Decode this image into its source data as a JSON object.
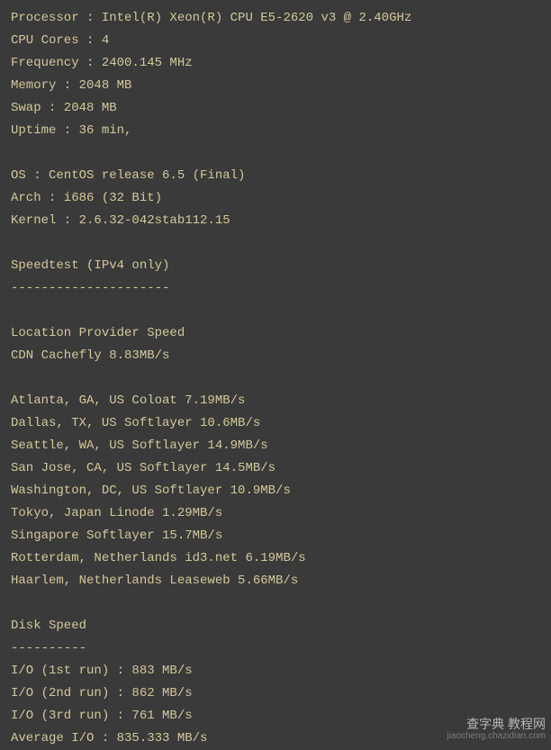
{
  "system": {
    "processor": "Processor : Intel(R) Xeon(R) CPU E5-2620 v3 @ 2.40GHz",
    "cores": "CPU Cores : 4",
    "frequency": "Frequency : 2400.145 MHz",
    "memory": "Memory : 2048 MB",
    "swap": "Swap : 2048 MB",
    "uptime": "Uptime : 36 min,"
  },
  "os_info": {
    "os": "OS : CentOS release 6.5 (Final)",
    "arch": "Arch : i686 (32 Bit)",
    "kernel": "Kernel : 2.6.32-042stab112.15"
  },
  "speedtest": {
    "header": "Speedtest (IPv4 only)",
    "divider": "---------------------",
    "section_header": "Location Provider Speed",
    "cdn": "CDN Cachefly 8.83MB/s",
    "locations": {
      "atlanta": "Atlanta, GA, US Coloat 7.19MB/s",
      "dallas": "Dallas, TX, US Softlayer 10.6MB/s",
      "seattle": "Seattle, WA, US Softlayer 14.9MB/s",
      "sanjose": "San Jose, CA, US Softlayer 14.5MB/s",
      "washington": "Washington, DC, US Softlayer 10.9MB/s",
      "tokyo": "Tokyo, Japan Linode 1.29MB/s",
      "singapore": "Singapore Softlayer 15.7MB/s",
      "rotterdam": "Rotterdam, Netherlands id3.net 6.19MB/s",
      "haarlem": "Haarlem, Netherlands Leaseweb 5.66MB/s"
    }
  },
  "disk": {
    "header": "Disk Speed",
    "divider": "----------",
    "run1": "I/O (1st run) : 883 MB/s",
    "run2": "I/O (2nd run) : 862 MB/s",
    "run3": "I/O (3rd run) : 761 MB/s",
    "average": "Average I/O : 835.333 MB/s"
  },
  "watermark": {
    "text1": "查字典 教程网",
    "text2": "jiaocheng.chazidian.com"
  }
}
